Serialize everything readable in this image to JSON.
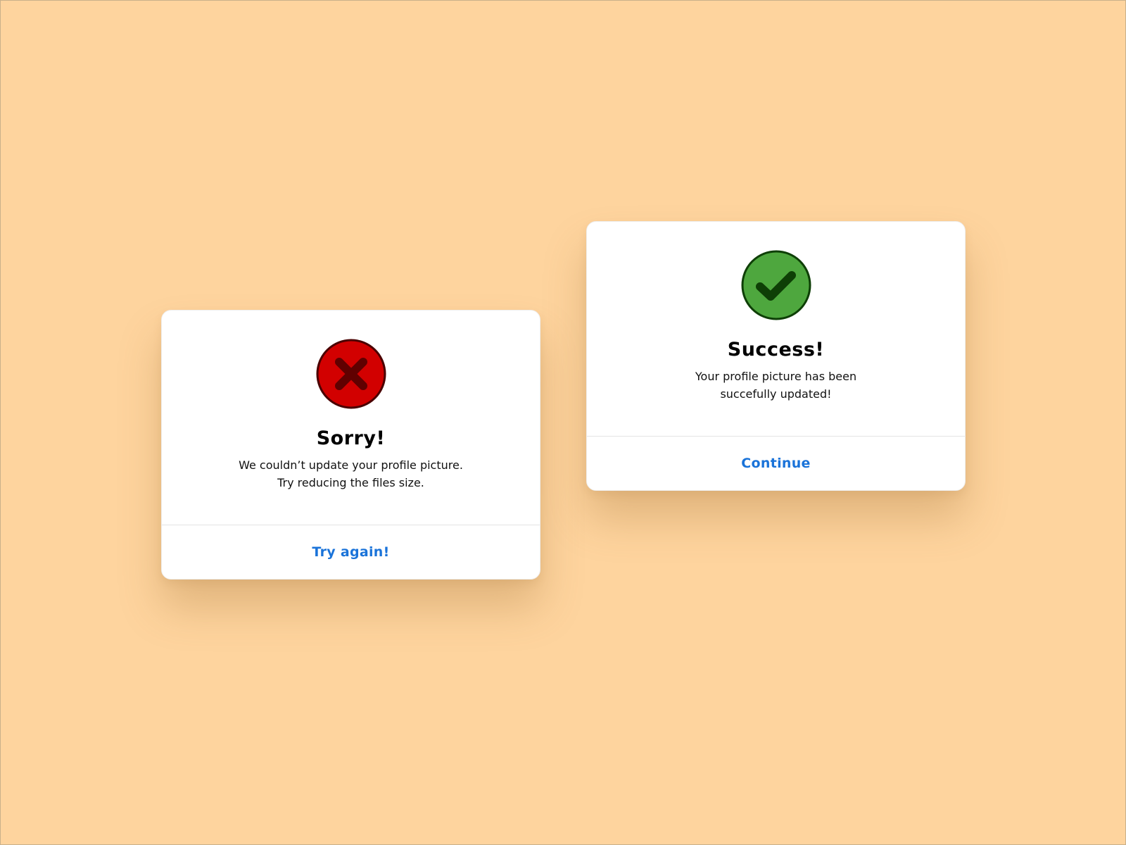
{
  "colors": {
    "background": "#fed49e",
    "card": "#ffffff",
    "action_link": "#1a73d9",
    "error_fill": "#d20000",
    "error_mark": "#600000",
    "success_fill": "#4ea73e",
    "success_mark": "#0e3f06"
  },
  "error_dialog": {
    "icon": "error-x-circle-icon",
    "title": "Sorry!",
    "message_line_1": "We couldn’t update your profile picture.",
    "message_line_2": "Try reducing the files size.",
    "action_label": "Try again!"
  },
  "success_dialog": {
    "icon": "success-check-circle-icon",
    "title": "Success!",
    "message_line_1": "Your profile picture has been",
    "message_line_2": "succefully updated!",
    "action_label": "Continue"
  }
}
